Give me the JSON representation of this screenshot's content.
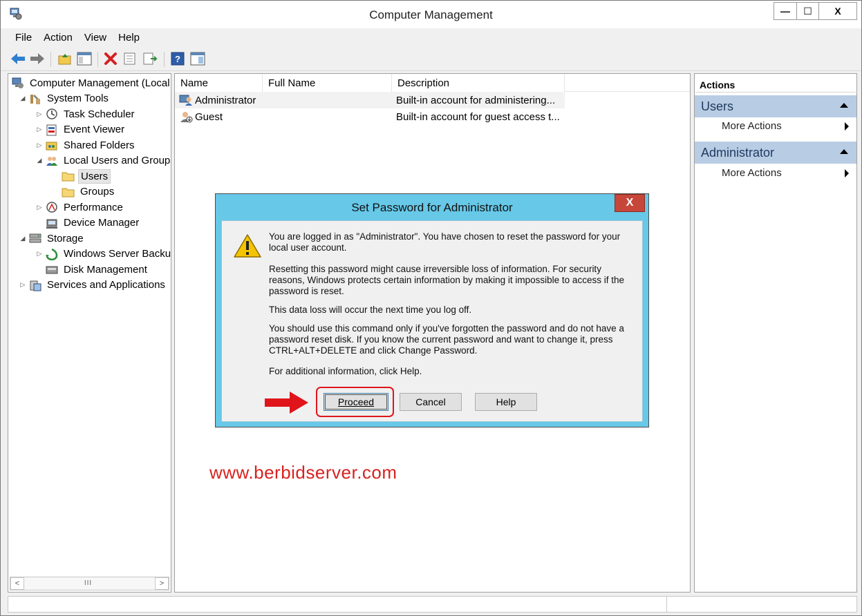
{
  "window": {
    "title": "Computer Management",
    "controls": {
      "minimize": "—",
      "maximize": "☐",
      "close": "X"
    }
  },
  "menu": [
    "File",
    "Action",
    "View",
    "Help"
  ],
  "tree": {
    "items": [
      {
        "label": "Computer Management (Local",
        "level": 0,
        "expander": "",
        "icon": "computer-management-icon"
      },
      {
        "label": "System Tools",
        "level": 1,
        "expander": "◢",
        "icon": "system-tools-icon"
      },
      {
        "label": "Task Scheduler",
        "level": 2,
        "expander": "▷",
        "icon": "task-scheduler-icon"
      },
      {
        "label": "Event Viewer",
        "level": 2,
        "expander": "▷",
        "icon": "event-viewer-icon"
      },
      {
        "label": "Shared Folders",
        "level": 2,
        "expander": "▷",
        "icon": "shared-folders-icon"
      },
      {
        "label": "Local Users and Groups",
        "level": 2,
        "expander": "◢",
        "icon": "local-users-groups-icon"
      },
      {
        "label": "Users",
        "level": 3,
        "expander": "",
        "icon": "folder-icon",
        "selected": true
      },
      {
        "label": "Groups",
        "level": 3,
        "expander": "",
        "icon": "folder-icon"
      },
      {
        "label": "Performance",
        "level": 2,
        "expander": "▷",
        "icon": "performance-icon"
      },
      {
        "label": "Device Manager",
        "level": 2,
        "expander": "",
        "icon": "device-manager-icon"
      },
      {
        "label": "Storage",
        "level": 1,
        "expander": "◢",
        "icon": "storage-icon"
      },
      {
        "label": "Windows Server Backup",
        "level": 2,
        "expander": "▷",
        "icon": "server-backup-icon"
      },
      {
        "label": "Disk Management",
        "level": 2,
        "expander": "",
        "icon": "disk-management-icon"
      },
      {
        "label": "Services and Applications",
        "level": 1,
        "expander": "▷",
        "icon": "services-icon"
      }
    ],
    "scroll_thumb": "III"
  },
  "list": {
    "columns": [
      "Name",
      "Full Name",
      "Description"
    ],
    "rows": [
      {
        "name": "Administrator",
        "full_name": "",
        "description": "Built-in account for administering...",
        "icon": "user-icon"
      },
      {
        "name": "Guest",
        "full_name": "",
        "description": "Built-in account for guest access t...",
        "icon": "guest-user-icon"
      }
    ]
  },
  "actions": {
    "title": "Actions",
    "sections": [
      {
        "header": "Users",
        "items": [
          "More Actions"
        ]
      },
      {
        "header": "Administrator",
        "items": [
          "More Actions"
        ]
      }
    ]
  },
  "dialog": {
    "title": "Set Password for Administrator",
    "close": "X",
    "paragraphs": [
      "You are logged in as \"Administrator\". You have chosen to reset the password for your local user account.",
      "Resetting this password might cause irreversible loss of information. For security reasons, Windows protects certain information by making it impossible to access if the password is reset.",
      "This data loss will occur the next time you log off.",
      "You should use this command only if you've forgotten the password and do not have a password reset disk. If you know the current password and want to change it, press CTRL+ALT+DELETE and click Change Password.",
      "For additional information, click Help."
    ],
    "buttons": {
      "proceed": "Proceed",
      "cancel": "Cancel",
      "help": "Help"
    }
  },
  "watermark": "www.berbidserver.com",
  "colors": {
    "dialog_frame": "#67c8e8",
    "actions_header": "#b8cce4",
    "annotation_red": "#e0141b"
  }
}
